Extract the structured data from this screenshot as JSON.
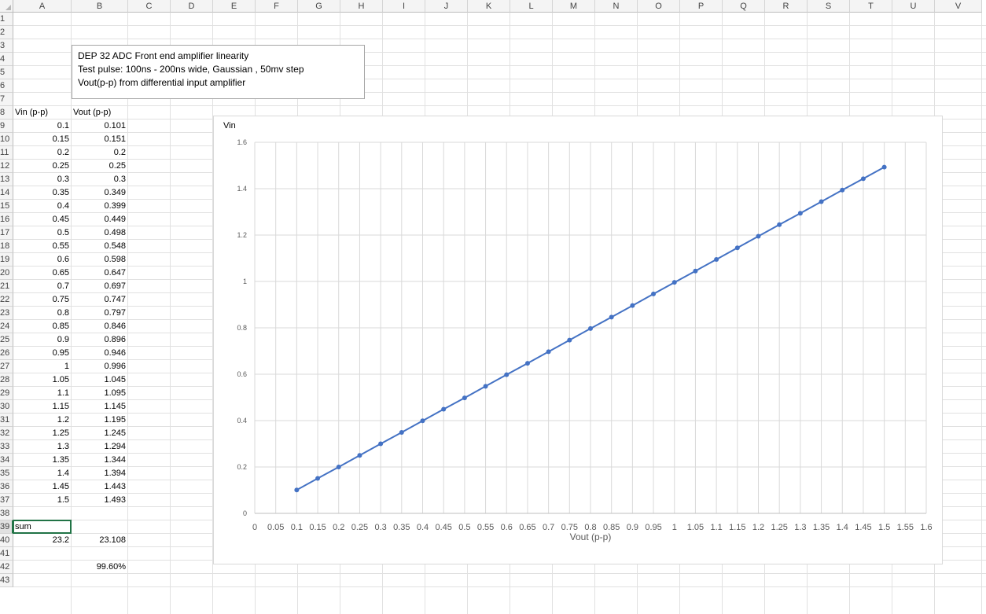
{
  "sheet": {
    "columns": [
      "A",
      "B",
      "C",
      "D",
      "E",
      "F",
      "G",
      "H",
      "I",
      "J",
      "K",
      "L",
      "M",
      "N",
      "O",
      "P",
      "Q",
      "R",
      "S",
      "T",
      "U",
      "V"
    ],
    "rows": [
      "1",
      "2",
      "3",
      "4",
      "5",
      "6",
      "7",
      "8",
      "9",
      "10",
      "11",
      "12",
      "13",
      "14",
      "15",
      "16",
      "17",
      "18",
      "19",
      "20",
      "21",
      "22",
      "23",
      "24",
      "25",
      "26",
      "27",
      "28",
      "29",
      "30",
      "31",
      "32",
      "33",
      "34",
      "35",
      "36",
      "37",
      "38",
      "39",
      "40",
      "41",
      "42",
      "43"
    ],
    "active_cell": "A39",
    "header_a": "Vin (p-p)",
    "header_b": "Vout (p-p)",
    "vin": [
      "0.1",
      "0.15",
      "0.2",
      "0.25",
      "0.3",
      "0.35",
      "0.4",
      "0.45",
      "0.5",
      "0.55",
      "0.6",
      "0.65",
      "0.7",
      "0.75",
      "0.8",
      "0.85",
      "0.9",
      "0.95",
      "1",
      "1.05",
      "1.1",
      "1.15",
      "1.2",
      "1.25",
      "1.3",
      "1.35",
      "1.4",
      "1.45",
      "1.5"
    ],
    "vout": [
      "0.101",
      "0.151",
      "0.2",
      "0.25",
      "0.3",
      "0.349",
      "0.399",
      "0.449",
      "0.498",
      "0.548",
      "0.598",
      "0.647",
      "0.697",
      "0.747",
      "0.797",
      "0.846",
      "0.896",
      "0.946",
      "0.996",
      "1.045",
      "1.095",
      "1.145",
      "1.195",
      "1.245",
      "1.294",
      "1.344",
      "1.394",
      "1.443",
      "1.493"
    ],
    "sum_label": "sum",
    "sum_a": "23.2",
    "sum_b": "23.108",
    "ratio": "99.60%"
  },
  "textbox": {
    "line1": "DEP 32 ADC Front end amplifier linearity",
    "line2": "Test pulse: 100ns -  200ns wide, Gaussian , 50mv step",
    "line3": "Vout(p-p) from differential input  amplifier"
  },
  "colors": {
    "series": "#4472c4",
    "grid": "#d9d9d9"
  },
  "chart_data": {
    "type": "line",
    "title": "Vin",
    "xlabel": "Vout (p-p)",
    "ylabel": "",
    "xlim": [
      0,
      1.6
    ],
    "ylim": [
      0,
      1.6
    ],
    "x_ticks": [
      "0",
      "0.05",
      "0.1",
      "0.15",
      "0.2",
      "0.25",
      "0.3",
      "0.35",
      "0.4",
      "0.45",
      "0.5",
      "0.55",
      "0.6",
      "0.65",
      "0.7",
      "0.75",
      "0.8",
      "0.85",
      "0.9",
      "0.95",
      "1",
      "1.05",
      "1.1",
      "1.15",
      "1.2",
      "1.25",
      "1.3",
      "1.35",
      "1.4",
      "1.45",
      "1.5",
      "1.55",
      "1.6"
    ],
    "y_ticks": [
      "0",
      "0.2",
      "0.4",
      "0.6",
      "0.8",
      "1",
      "1.2",
      "1.4",
      "1.6"
    ],
    "grid": true,
    "legend": "none",
    "x": [
      0.1,
      0.15,
      0.2,
      0.25,
      0.3,
      0.35,
      0.4,
      0.45,
      0.5,
      0.55,
      0.6,
      0.65,
      0.7,
      0.75,
      0.8,
      0.85,
      0.9,
      0.95,
      1,
      1.05,
      1.1,
      1.15,
      1.2,
      1.25,
      1.3,
      1.35,
      1.4,
      1.45,
      1.5
    ],
    "y": [
      0.101,
      0.151,
      0.2,
      0.25,
      0.3,
      0.349,
      0.399,
      0.449,
      0.498,
      0.548,
      0.598,
      0.647,
      0.697,
      0.747,
      0.797,
      0.846,
      0.896,
      0.946,
      0.996,
      1.045,
      1.095,
      1.145,
      1.195,
      1.245,
      1.294,
      1.344,
      1.394,
      1.443,
      1.493
    ]
  }
}
